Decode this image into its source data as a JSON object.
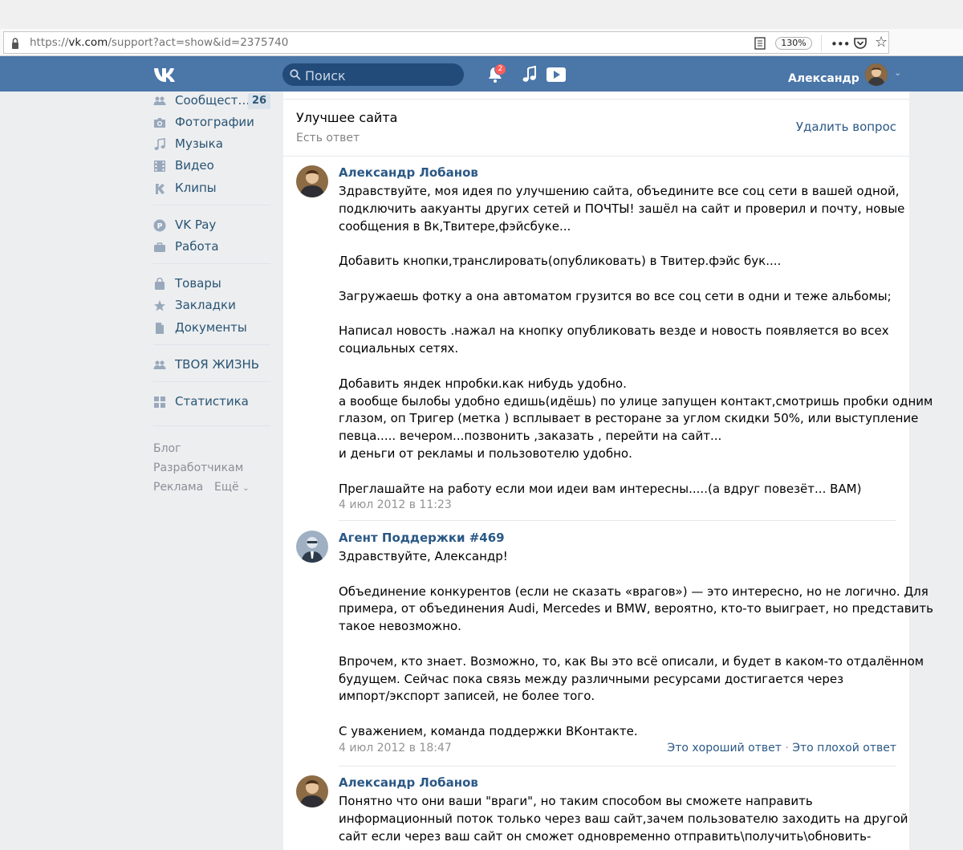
{
  "browser": {
    "url_prefix": "https://",
    "url_host": "vk.com",
    "url_path": "/support?act=show&id=2375740",
    "zoom": "130%"
  },
  "header": {
    "search_placeholder": "Поиск",
    "notifications_count": "2",
    "user_name": "Александр"
  },
  "sidebar": {
    "items": [
      {
        "label": "Сообщест…",
        "icon": "groups-icon",
        "count": "26"
      },
      {
        "label": "Фотографии",
        "icon": "camera-icon"
      },
      {
        "label": "Музыка",
        "icon": "music-note-icon"
      },
      {
        "label": "Видео",
        "icon": "film-icon"
      },
      {
        "label": "Клипы",
        "icon": "clips-icon"
      },
      {
        "label": "VK Pay",
        "icon": "vkpay-icon"
      },
      {
        "label": "Работа",
        "icon": "briefcase-icon"
      },
      {
        "label": "Товары",
        "icon": "shopping-bag-icon"
      },
      {
        "label": "Закладки",
        "icon": "star-icon"
      },
      {
        "label": "Документы",
        "icon": "document-icon"
      },
      {
        "label": "ТВОЯ ЖИЗНЬ",
        "icon": "groups-icon"
      },
      {
        "label": "Статистика",
        "icon": "stats-icon"
      }
    ],
    "footer": {
      "blog": "Блог",
      "developers": "Разработчикам",
      "ads": "Реклама",
      "more": "Ещё"
    }
  },
  "question": {
    "title": "Улучшее сайта",
    "status": "Есть ответ",
    "delete_label": "Удалить вопрос"
  },
  "posts": [
    {
      "author": "Александр Лобанов",
      "lines": [
        "Здравствуйте, моя идея по улучшению сайта, объедините все соц сети в вашей одной,",
        "подключить аакуанты других сетей и ПОЧТЫ! зашёл на сайт и проверил и почту, новые",
        "сообщения в Вк,Твитере,фэйсбуке...",
        "",
        "Добавить кнопки,транслировать(опубликовать) в Твитер.фэйс бук....",
        "",
        "Загружаешь фотку а она автоматом грузится во все соц сети в одни и теже альбомы;",
        "",
        "Написал новость .нажал на кнопку опубликовать везде и новость появляется во всех",
        "социальных сетях.",
        "",
        "Добавить яндек нпробки.как нибудь удобно.",
        "а вообще былобы удобно едишь(идёшь) по улице запущен контакт,смотришь пробки одним",
        "глазом, оп Тригер (метка ) всплывает в ресторане за углом скидки 50%, или выступление",
        "певца..... вечером...позвонить ,заказать , перейти на сайт...",
        "и деньги от рекламы и пользовотелю удобно.",
        "",
        "Преглашайте на работу если мои идеи вам интересны.....(а вдруг повезёт... ВАМ)"
      ],
      "date": "4 июл 2012 в 11:23"
    },
    {
      "author": "Агент Поддержки #469",
      "lines": [
        "Здравствуйте, Александр!",
        "",
        "Объединение конкурентов (если не сказать «врагов») — это интересно, но не логично. Для",
        "примера, от объединения Audi, Mercedes и BMW, вероятно, кто-то выиграет, но представить",
        "такое невозможно.",
        "",
        "Впрочем, кто знает. Возможно, то, как Вы это всё описали, и будет в каком-то отдалённом",
        "будущем. Сейчас пока связь между различными ресурсами достигается через",
        "импорт/экспорт записей, не более того.",
        "",
        "С уважением, команда поддержки ВКонтакте."
      ],
      "date": "4 июл 2012 в 18:47",
      "good_answer": "Это хороший ответ",
      "separator": "·",
      "bad_answer": "Это плохой ответ"
    },
    {
      "author": "Александр Лобанов",
      "lines": [
        "Понятно что они ваши \"враги\", но таким способом вы сможете направить",
        "информационный поток только через ваш сайт,зачем пользователю заходить на другой",
        "сайт если через ваш сайт он сможет одновременно отправить\\получить\\обновить-"
      ]
    }
  ]
}
